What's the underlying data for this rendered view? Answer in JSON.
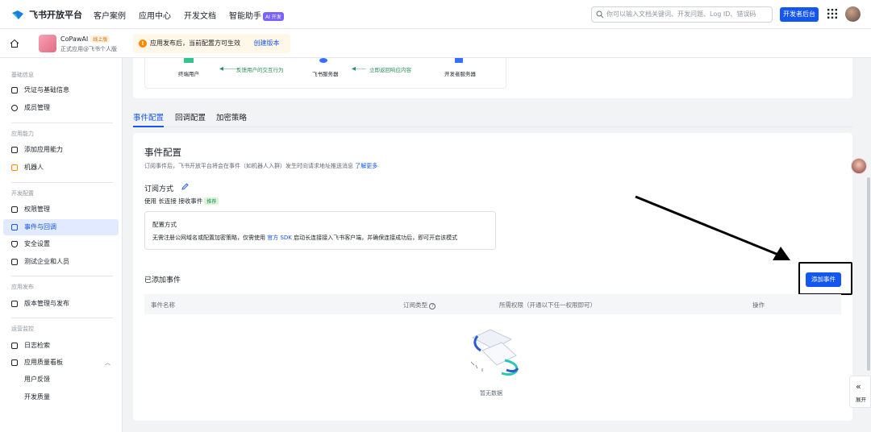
{
  "topbar": {
    "logo_text": "飞书开放平台",
    "nav": [
      "客户案例",
      "应用中心",
      "开发文档",
      "智能助手"
    ],
    "ai_badge": "AI 开发",
    "search_placeholder": "你可以输入文档关键词、开发问题、Log ID、错误码",
    "dev_console_label": "开发者后台"
  },
  "subbar": {
    "app_name": "CoPawAI",
    "live_badge": "线上版",
    "app_sub": "正式应用@飞书个人版",
    "notice_text": "应用发布后，当前配置方可生效",
    "notice_link": "创建版本"
  },
  "sidebar": {
    "sections": [
      {
        "title": "基础信息",
        "items": [
          "凭证与基础信息",
          "成员管理"
        ]
      },
      {
        "title": "应用能力",
        "items": [
          "添加应用能力",
          "机器人"
        ]
      },
      {
        "title": "开发配置",
        "items": [
          "权限管理",
          "事件与回调",
          "安全设置",
          "测试企业和人员"
        ]
      },
      {
        "title": "应用发布",
        "items": [
          "版本管理与发布"
        ]
      },
      {
        "title": "运营监控",
        "items": [
          "日志检索",
          "应用质量看板",
          "用户反馈",
          "开发质量"
        ]
      }
    ],
    "active_item": "事件与回调"
  },
  "flow": {
    "labels": [
      "终端用户",
      "反馈用户的交互行为",
      "飞书服务器",
      "立即返回响应内容",
      "开发者服务器"
    ]
  },
  "tabs": [
    "事件配置",
    "回调配置",
    "加密策略"
  ],
  "event_config": {
    "title": "事件配置",
    "desc": "订阅事件后，飞书开放平台将会在事件（如机器人入群）发生时向请求地址推送消息",
    "desc_link": "了解更多",
    "sub_title": "订阅方式",
    "connection_prefix": "使用 长连接 接收事件",
    "recommend_badge": "推荐",
    "config_title": "配置方式",
    "config_text_1": "无需注册公网域名或配置加密策略，仅需使用",
    "config_link": "官方 SDK",
    "config_text_2": "启动长连接接入飞书客户端，并确保连接成功后，即可开启该模式"
  },
  "added_events": {
    "title": "已添加事件",
    "add_button": "添加事件",
    "columns": [
      "事件名称",
      "订阅类型",
      "所需权限（开通以下任一权限即可）",
      "操作"
    ],
    "empty_text": "暂无数据"
  },
  "expand_label": "展开",
  "colors": {
    "primary": "#1456f0",
    "active_bg": "#e1eaff",
    "notice_bg": "#fff7e8"
  }
}
